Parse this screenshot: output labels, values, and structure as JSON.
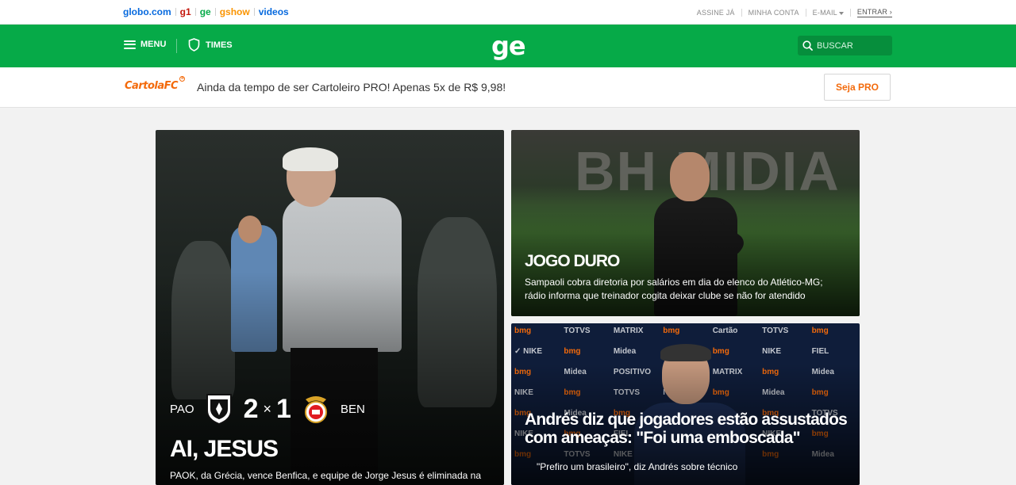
{
  "topbar": {
    "sites": [
      {
        "label": "globo.com",
        "color": "#0669de"
      },
      {
        "label": "g1",
        "color": "#c4170c"
      },
      {
        "label": "ge",
        "color": "#06aa48"
      },
      {
        "label": "gshow",
        "color": "#fa9400"
      },
      {
        "label": "videos",
        "color": "#0669de"
      }
    ],
    "links": {
      "subscribe": "ASSINE JÁ",
      "account": "MINHA CONTA",
      "email": "E-MAIL",
      "login": "ENTRAR"
    }
  },
  "header": {
    "menu_label": "MENU",
    "times_label": "TIMES",
    "logo": "ge",
    "search_placeholder": "BUSCAR",
    "brand_color": "#06aa48"
  },
  "promo": {
    "logo_text": "CartolaFC",
    "text": "Ainda da tempo de ser Cartoleiro PRO! Apenas 5x de R$ 9,98!",
    "button_label": "Seja PRO",
    "accent_color": "#f36a0b"
  },
  "cards": {
    "main": {
      "score": {
        "home_team": "PAO",
        "home_score": "2",
        "separator": "×",
        "away_score": "1",
        "away_team": "BEN"
      },
      "title": "AI, JESUS",
      "summary": "PAOK, da Grécia, vence Benfica, e equipe de Jorge Jesus é eliminada na fase"
    },
    "top_right": {
      "title": "JOGO DURO",
      "summary": "Sampaoli cobra diretoria por salários em dia do elenco do Atlético-MG; rádio informa que treinador cogita deixar clube se não for atendido",
      "banner": "BH MIDIA"
    },
    "bottom_right": {
      "title": "Andrés diz que jogadores estão assustados com ameaças: \"Foi uma emboscada\"",
      "summary": "\"Prefiro um brasileiro\", diz Andrés sobre técnico"
    }
  }
}
